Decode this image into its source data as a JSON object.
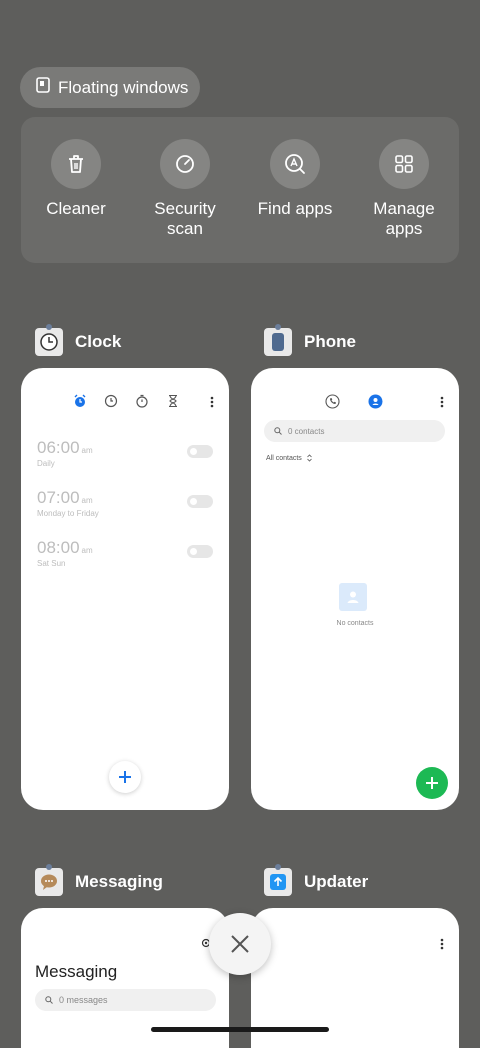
{
  "floating_windows": {
    "label": "Floating windows"
  },
  "quick_actions": [
    {
      "label": "Cleaner",
      "icon": "trash-icon"
    },
    {
      "label": "Security scan",
      "icon": "security-scan-icon"
    },
    {
      "label": "Find apps",
      "icon": "find-apps-icon"
    },
    {
      "label": "Manage apps",
      "icon": "manage-apps-icon"
    }
  ],
  "apps": {
    "clock": {
      "name": "Clock",
      "alarms": [
        {
          "time": "06:00",
          "ampm": "am",
          "repeat": "Daily"
        },
        {
          "time": "07:00",
          "ampm": "am",
          "repeat": "Monday to Friday"
        },
        {
          "time": "08:00",
          "ampm": "am",
          "repeat": "Sat Sun"
        }
      ],
      "accent": "#1a73e8"
    },
    "phone": {
      "name": "Phone",
      "search_placeholder": "0 contacts",
      "filter": "All contacts",
      "empty_text": "No contacts",
      "accent": "#1db954"
    },
    "messaging": {
      "name": "Messaging",
      "title": "Messaging",
      "search_placeholder": "0 messages"
    },
    "updater": {
      "name": "Updater"
    }
  },
  "colors": {
    "background": "#5e5e5c",
    "clock_accent": "#1a73e8",
    "phone_fab": "#1db954",
    "contacts_tab": "#1a73e8"
  }
}
